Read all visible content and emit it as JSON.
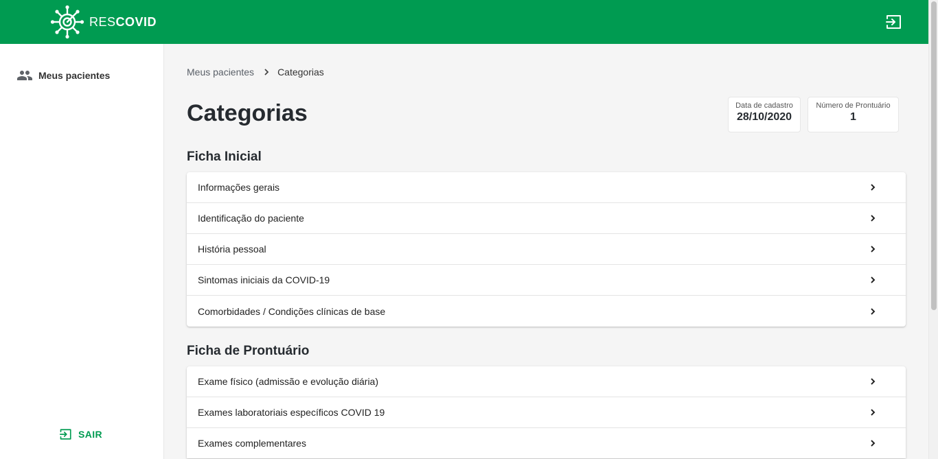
{
  "app": {
    "logo_prefix": "RES",
    "logo_suffix": "COVID",
    "accent_color": "#009b51"
  },
  "header": {
    "exit_icon": "exit-to-app-icon"
  },
  "sidebar": {
    "items": [
      {
        "label": "Meus pacientes",
        "icon": "people-icon"
      }
    ],
    "logout_label": "SAIR",
    "logout_icon": "exit-to-app-icon"
  },
  "breadcrumb": {
    "parent": "Meus pacientes",
    "current": "Categorias"
  },
  "page": {
    "title": "Categorias"
  },
  "info_cards": {
    "date": {
      "label": "Data de cadastro",
      "value": "28/10/2020"
    },
    "record": {
      "label": "Número de Prontuário",
      "value": "1"
    }
  },
  "sections": [
    {
      "title": "Ficha Inicial",
      "items": [
        "Informações gerais",
        "Identificação do paciente",
        "História pessoal",
        "Sintomas iniciais da COVID-19",
        "Comorbidades / Condições clínicas de base"
      ]
    },
    {
      "title": "Ficha de Prontuário",
      "items": [
        "Exame físico (admissão e evolução diária)",
        "Exames laboratoriais específicos COVID 19",
        "Exames complementares"
      ]
    }
  ]
}
